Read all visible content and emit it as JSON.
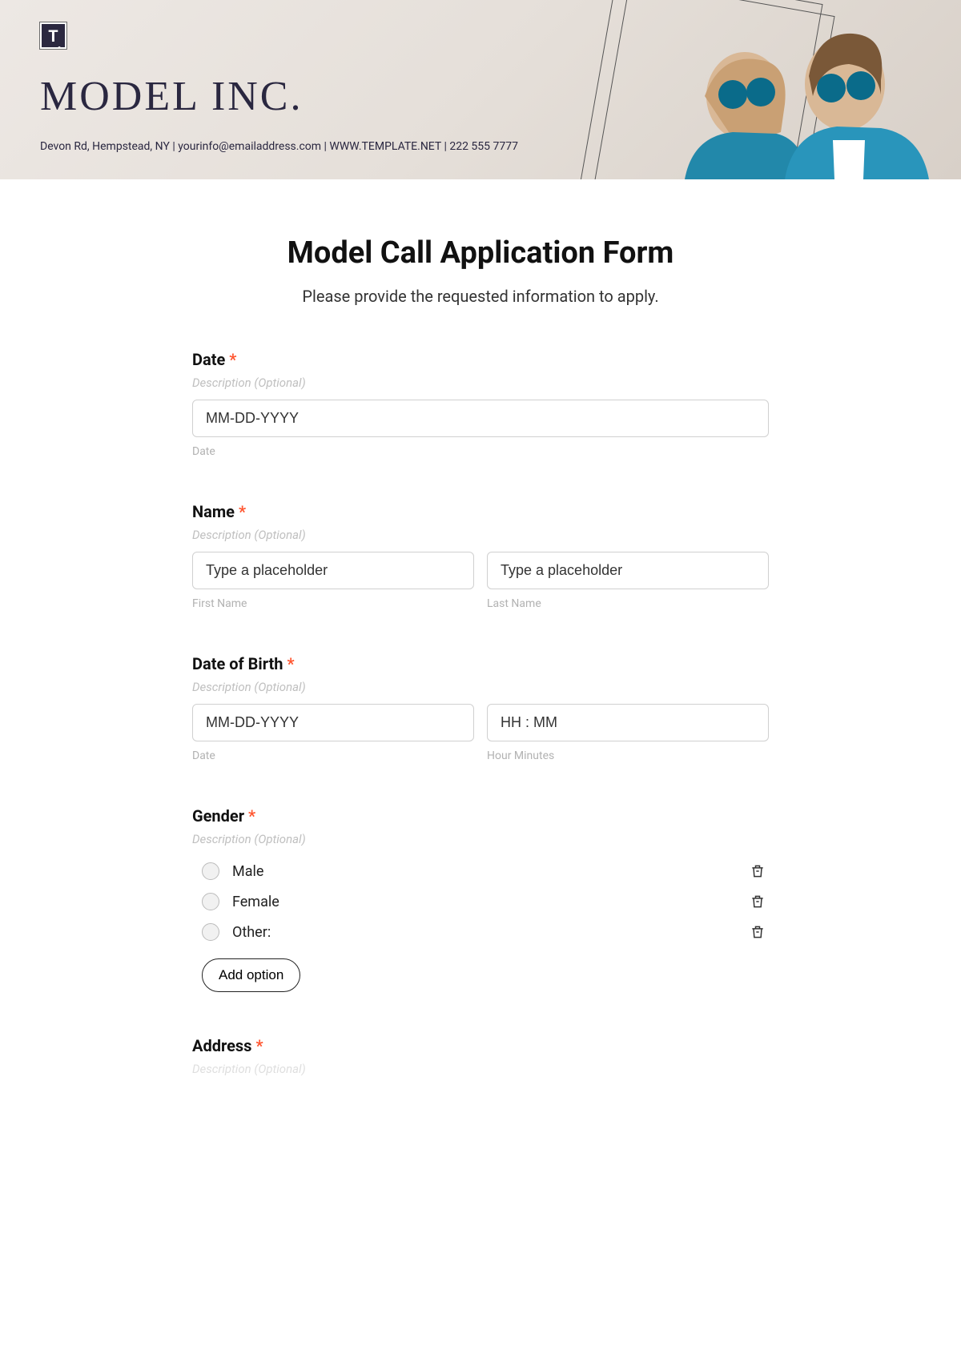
{
  "header": {
    "logo_letter": "T",
    "company_name": "MODEL INC.",
    "company_info": "Devon Rd, Hempstead, NY | yourinfo@emailaddress.com | WWW.TEMPLATE.NET | 222 555 7777"
  },
  "form": {
    "title": "Model Call Application Form",
    "subtitle": "Please provide the requested information to apply.",
    "description_placeholder": "Description (Optional)",
    "fields": {
      "date": {
        "label": "Date",
        "placeholder": "MM-DD-YYYY",
        "sublabel": "Date"
      },
      "name": {
        "label": "Name",
        "first_placeholder": "Type a placeholder",
        "last_placeholder": "Type a placeholder",
        "first_sublabel": "First Name",
        "last_sublabel": "Last Name"
      },
      "dob": {
        "label": "Date of Birth",
        "date_placeholder": "MM-DD-YYYY",
        "time_placeholder": "HH : MM",
        "date_sublabel": "Date",
        "time_sublabel": "Hour Minutes"
      },
      "gender": {
        "label": "Gender",
        "options": [
          "Male",
          "Female",
          "Other:"
        ],
        "add_button": "Add option"
      },
      "address": {
        "label": "Address"
      }
    }
  }
}
